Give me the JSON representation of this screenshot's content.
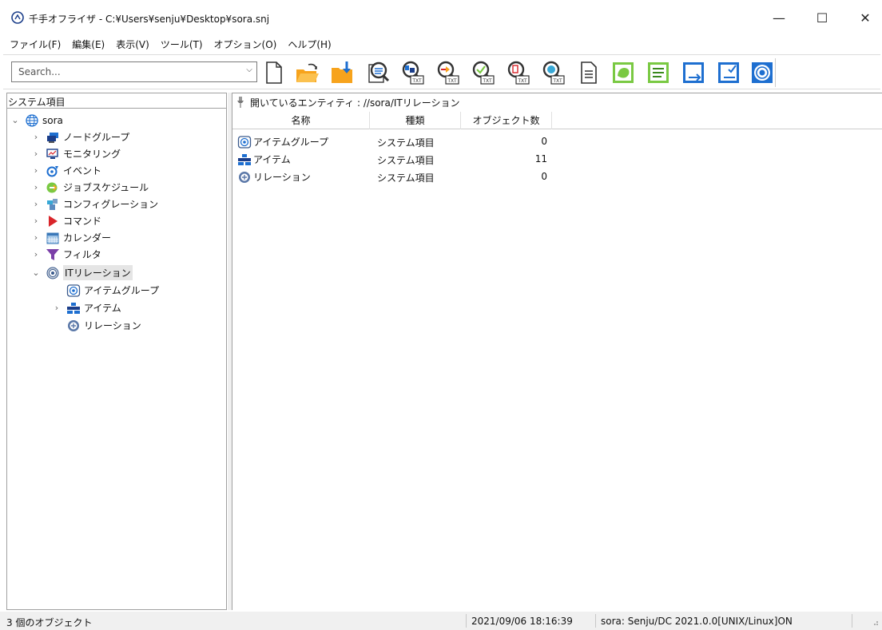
{
  "window": {
    "title": "千手オフライザ - C:¥Users¥senju¥Desktop¥sora.snj",
    "minimize": "—",
    "maximize": "☐",
    "close": "✕"
  },
  "menu": [
    "ファイル(F)",
    "編集(E)",
    "表示(V)",
    "ツール(T)",
    "オプション(O)",
    "ヘルプ(H)"
  ],
  "search": {
    "placeholder": "Search...",
    "dropdown": "⌵"
  },
  "left_pane": {
    "header": "システム項目",
    "tree": [
      {
        "label": "sora",
        "icon": "globe-icon",
        "arrow": "⌄"
      },
      {
        "label": "ノードグループ",
        "icon": "node-group-icon",
        "arrow": "›"
      },
      {
        "label": "モニタリング",
        "icon": "monitoring-icon",
        "arrow": "›"
      },
      {
        "label": "イベント",
        "icon": "event-icon",
        "arrow": "›"
      },
      {
        "label": "ジョブスケジュール",
        "icon": "job-schedule-icon",
        "arrow": "›"
      },
      {
        "label": "コンフィグレーション",
        "icon": "configuration-icon",
        "arrow": "›"
      },
      {
        "label": "コマンド",
        "icon": "command-icon",
        "arrow": "›"
      },
      {
        "label": "カレンダー",
        "icon": "calendar-icon",
        "arrow": "›"
      },
      {
        "label": "フィルタ",
        "icon": "filter-icon",
        "arrow": "›"
      },
      {
        "label": "ITリレーション",
        "icon": "it-relation-icon",
        "arrow": "⌄"
      },
      {
        "label": "アイテムグループ",
        "icon": "item-group-icon",
        "arrow": ""
      },
      {
        "label": "アイテム",
        "icon": "item-icon",
        "arrow": "›"
      },
      {
        "label": "リレーション",
        "icon": "relation-icon",
        "arrow": ""
      }
    ]
  },
  "right_pane": {
    "path": "開いているエンティティ : //sora/ITリレーション",
    "columns": [
      "名称",
      "種類",
      "オブジェクト数"
    ],
    "rows": [
      {
        "name": "アイテムグループ",
        "type": "システム項目",
        "count": "0",
        "icon": "item-group-icon"
      },
      {
        "name": "アイテム",
        "type": "システム項目",
        "count": "11",
        "icon": "item-icon"
      },
      {
        "name": "リレーション",
        "type": "システム項目",
        "count": "0",
        "icon": "relation-icon"
      }
    ]
  },
  "status": {
    "count": "3 個のオブジェクト",
    "timestamp": "2021/09/06 18:16:39",
    "connection": "sora: Senju/DC 2021.0.0[UNIX/Linux]ON"
  },
  "colors": {
    "accent_blue": "#1e6fd0",
    "green": "#7ac943",
    "orange": "#f7a31c",
    "red": "#d9252a"
  }
}
